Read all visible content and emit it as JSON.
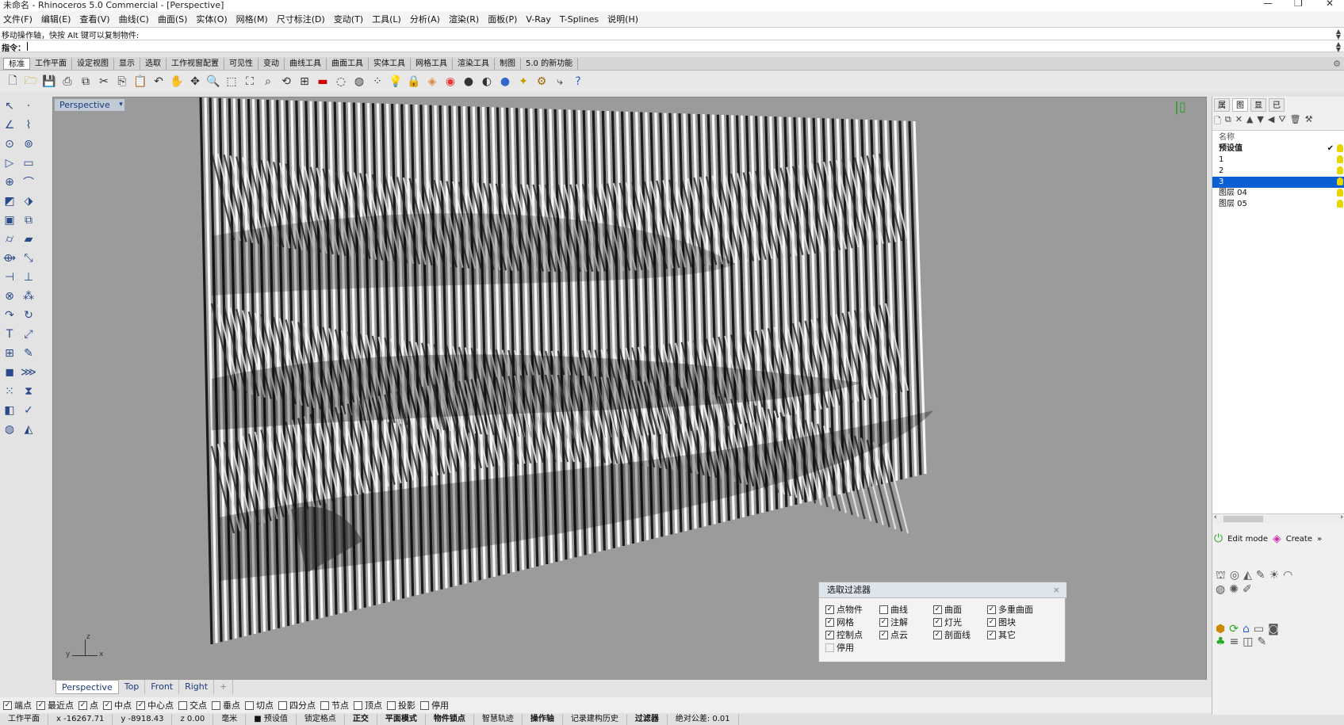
{
  "window": {
    "title": "未命名 - Rhinoceros 5.0 Commercial - [Perspective]",
    "controls": [
      "—",
      "❐",
      "✕"
    ]
  },
  "menu": [
    "文件(F)",
    "编辑(E)",
    "查看(V)",
    "曲线(C)",
    "曲面(S)",
    "实体(O)",
    "网格(M)",
    "尺寸标注(D)",
    "变动(T)",
    "工具(L)",
    "分析(A)",
    "渲染(R)",
    "面板(P)",
    "V-Ray",
    "T-Splines",
    "说明(H)"
  ],
  "command_history": "移动操作轴，快按 Alt 键可以复制物件:",
  "command_prompt": "指令：",
  "toolbar_tabs": [
    "标准",
    "工作平面",
    "设定视图",
    "显示",
    "选取",
    "工作视窗配置",
    "可见性",
    "变动",
    "曲线工具",
    "曲面工具",
    "实体工具",
    "网格工具",
    "渲染工具",
    "制图",
    "5.0 的新功能"
  ],
  "viewport": {
    "title": "Perspective",
    "axes": {
      "x": "x",
      "y": "y",
      "z": "z"
    }
  },
  "viewport_tabs": [
    "Perspective",
    "Top",
    "Front",
    "Right",
    "+"
  ],
  "osnap": [
    {
      "label": "端点",
      "checked": true
    },
    {
      "label": "最近点",
      "checked": true
    },
    {
      "label": "点",
      "checked": true
    },
    {
      "label": "中点",
      "checked": true
    },
    {
      "label": "中心点",
      "checked": true
    },
    {
      "label": "交点",
      "checked": false
    },
    {
      "label": "垂点",
      "checked": false
    },
    {
      "label": "切点",
      "checked": false
    },
    {
      "label": "四分点",
      "checked": false
    },
    {
      "label": "节点",
      "checked": false
    },
    {
      "label": "顶点",
      "checked": false
    },
    {
      "label": "投影",
      "checked": false
    },
    {
      "label": "停用",
      "checked": false
    }
  ],
  "status_bar": [
    "工作平面",
    "x -16267.71",
    "y -8918.43",
    "z 0.00",
    "毫米",
    "■ 预设值",
    "锁定格点",
    "正交",
    "平面模式",
    "物件锁点",
    "智慧轨迹",
    "操作轴",
    "记录建构历史",
    "过滤器",
    "绝对公差: 0.01"
  ],
  "right_panel": {
    "tabs": [
      "属",
      "图",
      "显",
      "已"
    ],
    "layers_header": "名称",
    "layers": [
      {
        "name": "预设值",
        "bold": true,
        "current": true
      },
      {
        "name": "1",
        "selected": false
      },
      {
        "name": "2",
        "selected": false
      },
      {
        "name": "3",
        "selected": true
      },
      {
        "name": "图层 04",
        "selected": false
      },
      {
        "name": "图层 05",
        "selected": false
      }
    ],
    "edit_mode": "Edit mode",
    "create": "Create"
  },
  "selection_filter": {
    "title": "选取过滤器",
    "items": [
      {
        "label": "点物件",
        "checked": true
      },
      {
        "label": "曲线",
        "checked": false
      },
      {
        "label": "曲面",
        "checked": true
      },
      {
        "label": "多重曲面",
        "checked": true
      },
      {
        "label": "网格",
        "checked": true
      },
      {
        "label": "注解",
        "checked": true
      },
      {
        "label": "灯光",
        "checked": true
      },
      {
        "label": "图块",
        "checked": true
      },
      {
        "label": "控制点",
        "checked": true
      },
      {
        "label": "点云",
        "checked": true
      },
      {
        "label": "剖面线",
        "checked": true
      },
      {
        "label": "其它",
        "checked": true
      },
      {
        "label": "停用",
        "checked": false
      }
    ]
  }
}
